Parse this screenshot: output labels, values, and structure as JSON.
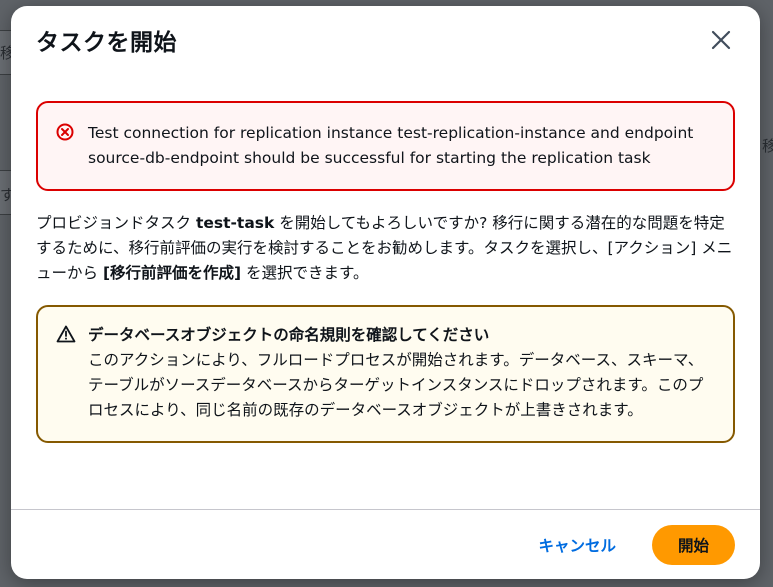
{
  "background": {
    "frag_top_left": "移",
    "frag_left_mid": "す",
    "frag_right_top": "移"
  },
  "modal": {
    "title": "タスクを開始",
    "close_icon": "close-icon",
    "error_alert": {
      "icon": "error-circle-x-icon",
      "text": "Test connection for replication instance test-replication-instance and endpoint source-db-endpoint should be successful for starting the replication task"
    },
    "description": {
      "part1": "プロビジョンドタスク ",
      "task_name": "test-task",
      "part2": " を開始してもよろしいですか? 移行に関する潜在的な問題を特定するために、移行前評価の実行を検討することをお勧めします。タスクを選択し、[アクション] メニューから ",
      "menu_item": "[移行前評価を作成]",
      "part3": " を選択できます。"
    },
    "warning_alert": {
      "icon": "warning-triangle-icon",
      "title": "データベースオブジェクトの命名規則を確認してください",
      "text": "このアクションにより、フルロードプロセスが開始されます。データベース、スキーマ、テーブルがソースデータベースからターゲットインスタンスにドロップされます。このプロセスにより、同じ名前の既存のデータベースオブジェクトが上書きされます。"
    },
    "footer": {
      "cancel_label": "キャンセル",
      "start_label": "開始"
    }
  },
  "colors": {
    "error_border": "#db0000",
    "warning_border": "#855900",
    "primary_button": "#ff9900",
    "link": "#006ce0"
  }
}
